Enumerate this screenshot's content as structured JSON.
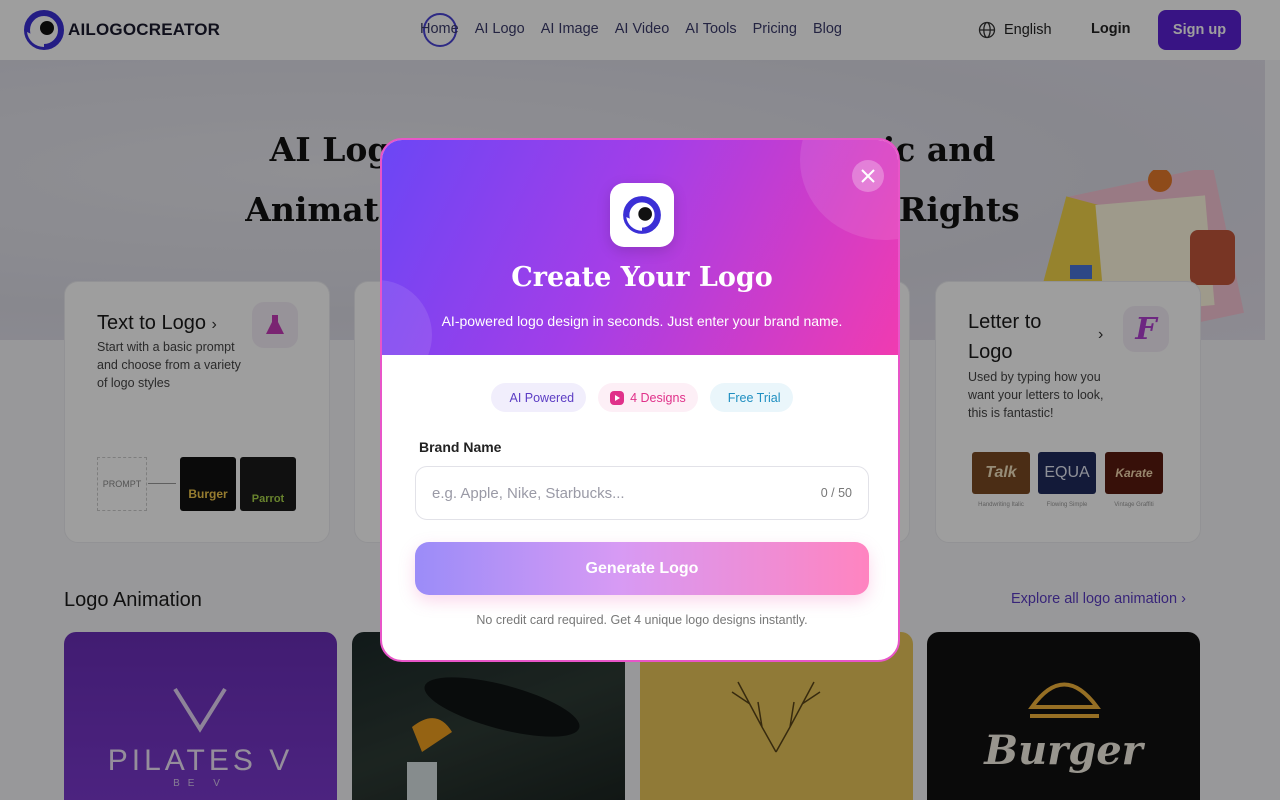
{
  "brand": {
    "name": "AILOGOCREATOR"
  },
  "nav": {
    "items": [
      {
        "label": "Home"
      },
      {
        "label": "AI Logo"
      },
      {
        "label": "AI Image"
      },
      {
        "label": "AI Video"
      },
      {
        "label": "AI Tools"
      },
      {
        "label": "Pricing"
      },
      {
        "label": "Blog"
      }
    ],
    "language": "English",
    "login": "Login",
    "signup": "Sign up"
  },
  "hero": {
    "line1_left": "AI Logo",
    "line1_right": "tic and",
    "line2_left": "Animat",
    "line2_right": "Rights"
  },
  "cards": {
    "text_to_logo": {
      "title": "Text to Logo",
      "desc": "Start with a basic prompt and choose from a variety of logo styles",
      "prompt_label": "PROMPT",
      "sample1": "Burger",
      "sample2": "Parrot"
    },
    "letter_to_logo": {
      "title": "Letter to Logo",
      "desc": "Used by typing how you want your letters to look, this is fantastic!",
      "samples": [
        {
          "text": "Talk",
          "caption": "Handwriting Italic"
        },
        {
          "text": "EQUA",
          "caption": "Flowing Simple"
        },
        {
          "text": "Karate",
          "caption": "Vintage Graffiti"
        }
      ]
    }
  },
  "animation": {
    "title": "Logo Animation",
    "explore": "Explore all logo animation",
    "tiles": [
      {
        "text": "PILATES V",
        "sub": "BE V"
      },
      {
        "text": ""
      },
      {
        "text": ""
      },
      {
        "text": "Burger"
      }
    ]
  },
  "modal": {
    "title": "Create Your Logo",
    "subtitle": "AI-powered logo design in seconds. Just enter your brand name.",
    "badges": [
      {
        "label": "AI Powered"
      },
      {
        "label": "4 Designs"
      },
      {
        "label": "Free Trial"
      }
    ],
    "field_label": "Brand Name",
    "placeholder": "e.g. Apple, Nike, Starbucks...",
    "value": "",
    "counter": "0 / 50",
    "button": "Generate Logo",
    "note": "No credit card required. Get 4 unique logo designs instantly."
  },
  "colors": {
    "accent": "#5b21d6",
    "modal_gradient_start": "#6b46f5",
    "modal_gradient_end": "#f13bb0",
    "button_gradient_start": "#9b8cf8",
    "button_gradient_end": "#ff84c0"
  }
}
